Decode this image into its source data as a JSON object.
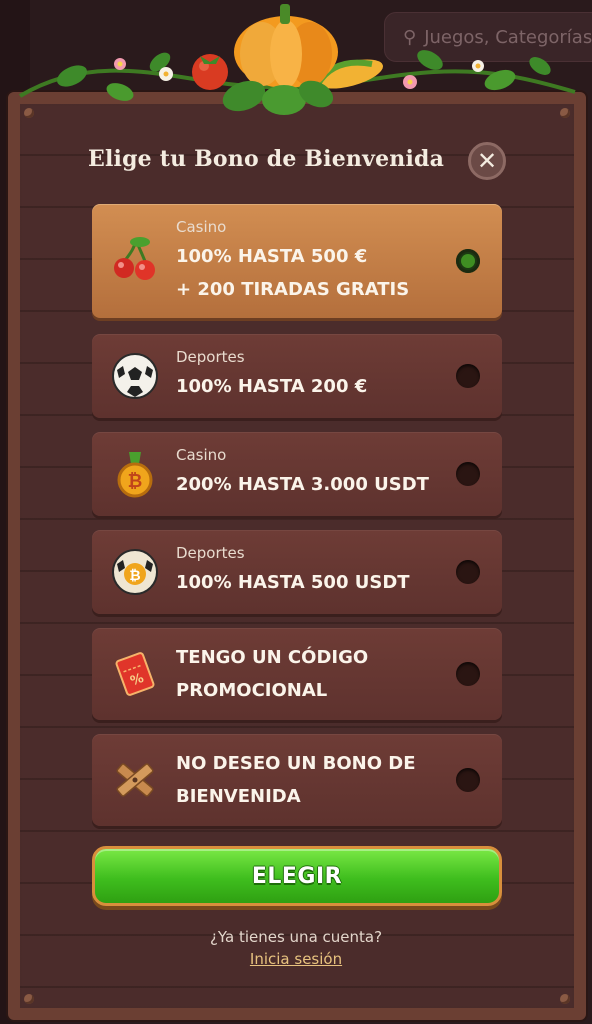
{
  "background": {
    "search_placeholder": "Juegos, Categorías"
  },
  "modal": {
    "title": "Elige tu Bono de Bienvenida",
    "close_symbol": "✕",
    "options": [
      {
        "category": "Casino",
        "line1": "100% HASTA 500 €",
        "line2": "+ 200 TIRADAS GRATIS",
        "icon": "cherries-icon",
        "selected": true
      },
      {
        "category": "Deportes",
        "line1": "100% HASTA 200 €",
        "line2": "",
        "icon": "soccer-ball-icon",
        "selected": false
      },
      {
        "category": "Casino",
        "line1": "200% HASTA 3.000 USDT",
        "line2": "",
        "icon": "bitcoin-medal-icon",
        "selected": false
      },
      {
        "category": "Deportes",
        "line1": "100% HASTA 500 USDT",
        "line2": "",
        "icon": "bitcoin-ball-icon",
        "selected": false
      },
      {
        "category": "",
        "line1": "TENGO UN CÓDIGO",
        "line2": "PROMOCIONAL",
        "icon": "coupon-icon",
        "selected": false
      },
      {
        "category": "",
        "line1": "NO DESEO UN BONO DE",
        "line2": "BIENVENIDA",
        "icon": "crossed-planks-icon",
        "selected": false
      }
    ],
    "cta_label": "ELEGIR",
    "account_question": "¿Ya tienes una cuenta?",
    "login_label": "Inicia sesión"
  },
  "colors": {
    "selected_option": "#c47e47",
    "option": "#66362f",
    "cta_green": "#47c424",
    "link": "#e7c27f"
  }
}
